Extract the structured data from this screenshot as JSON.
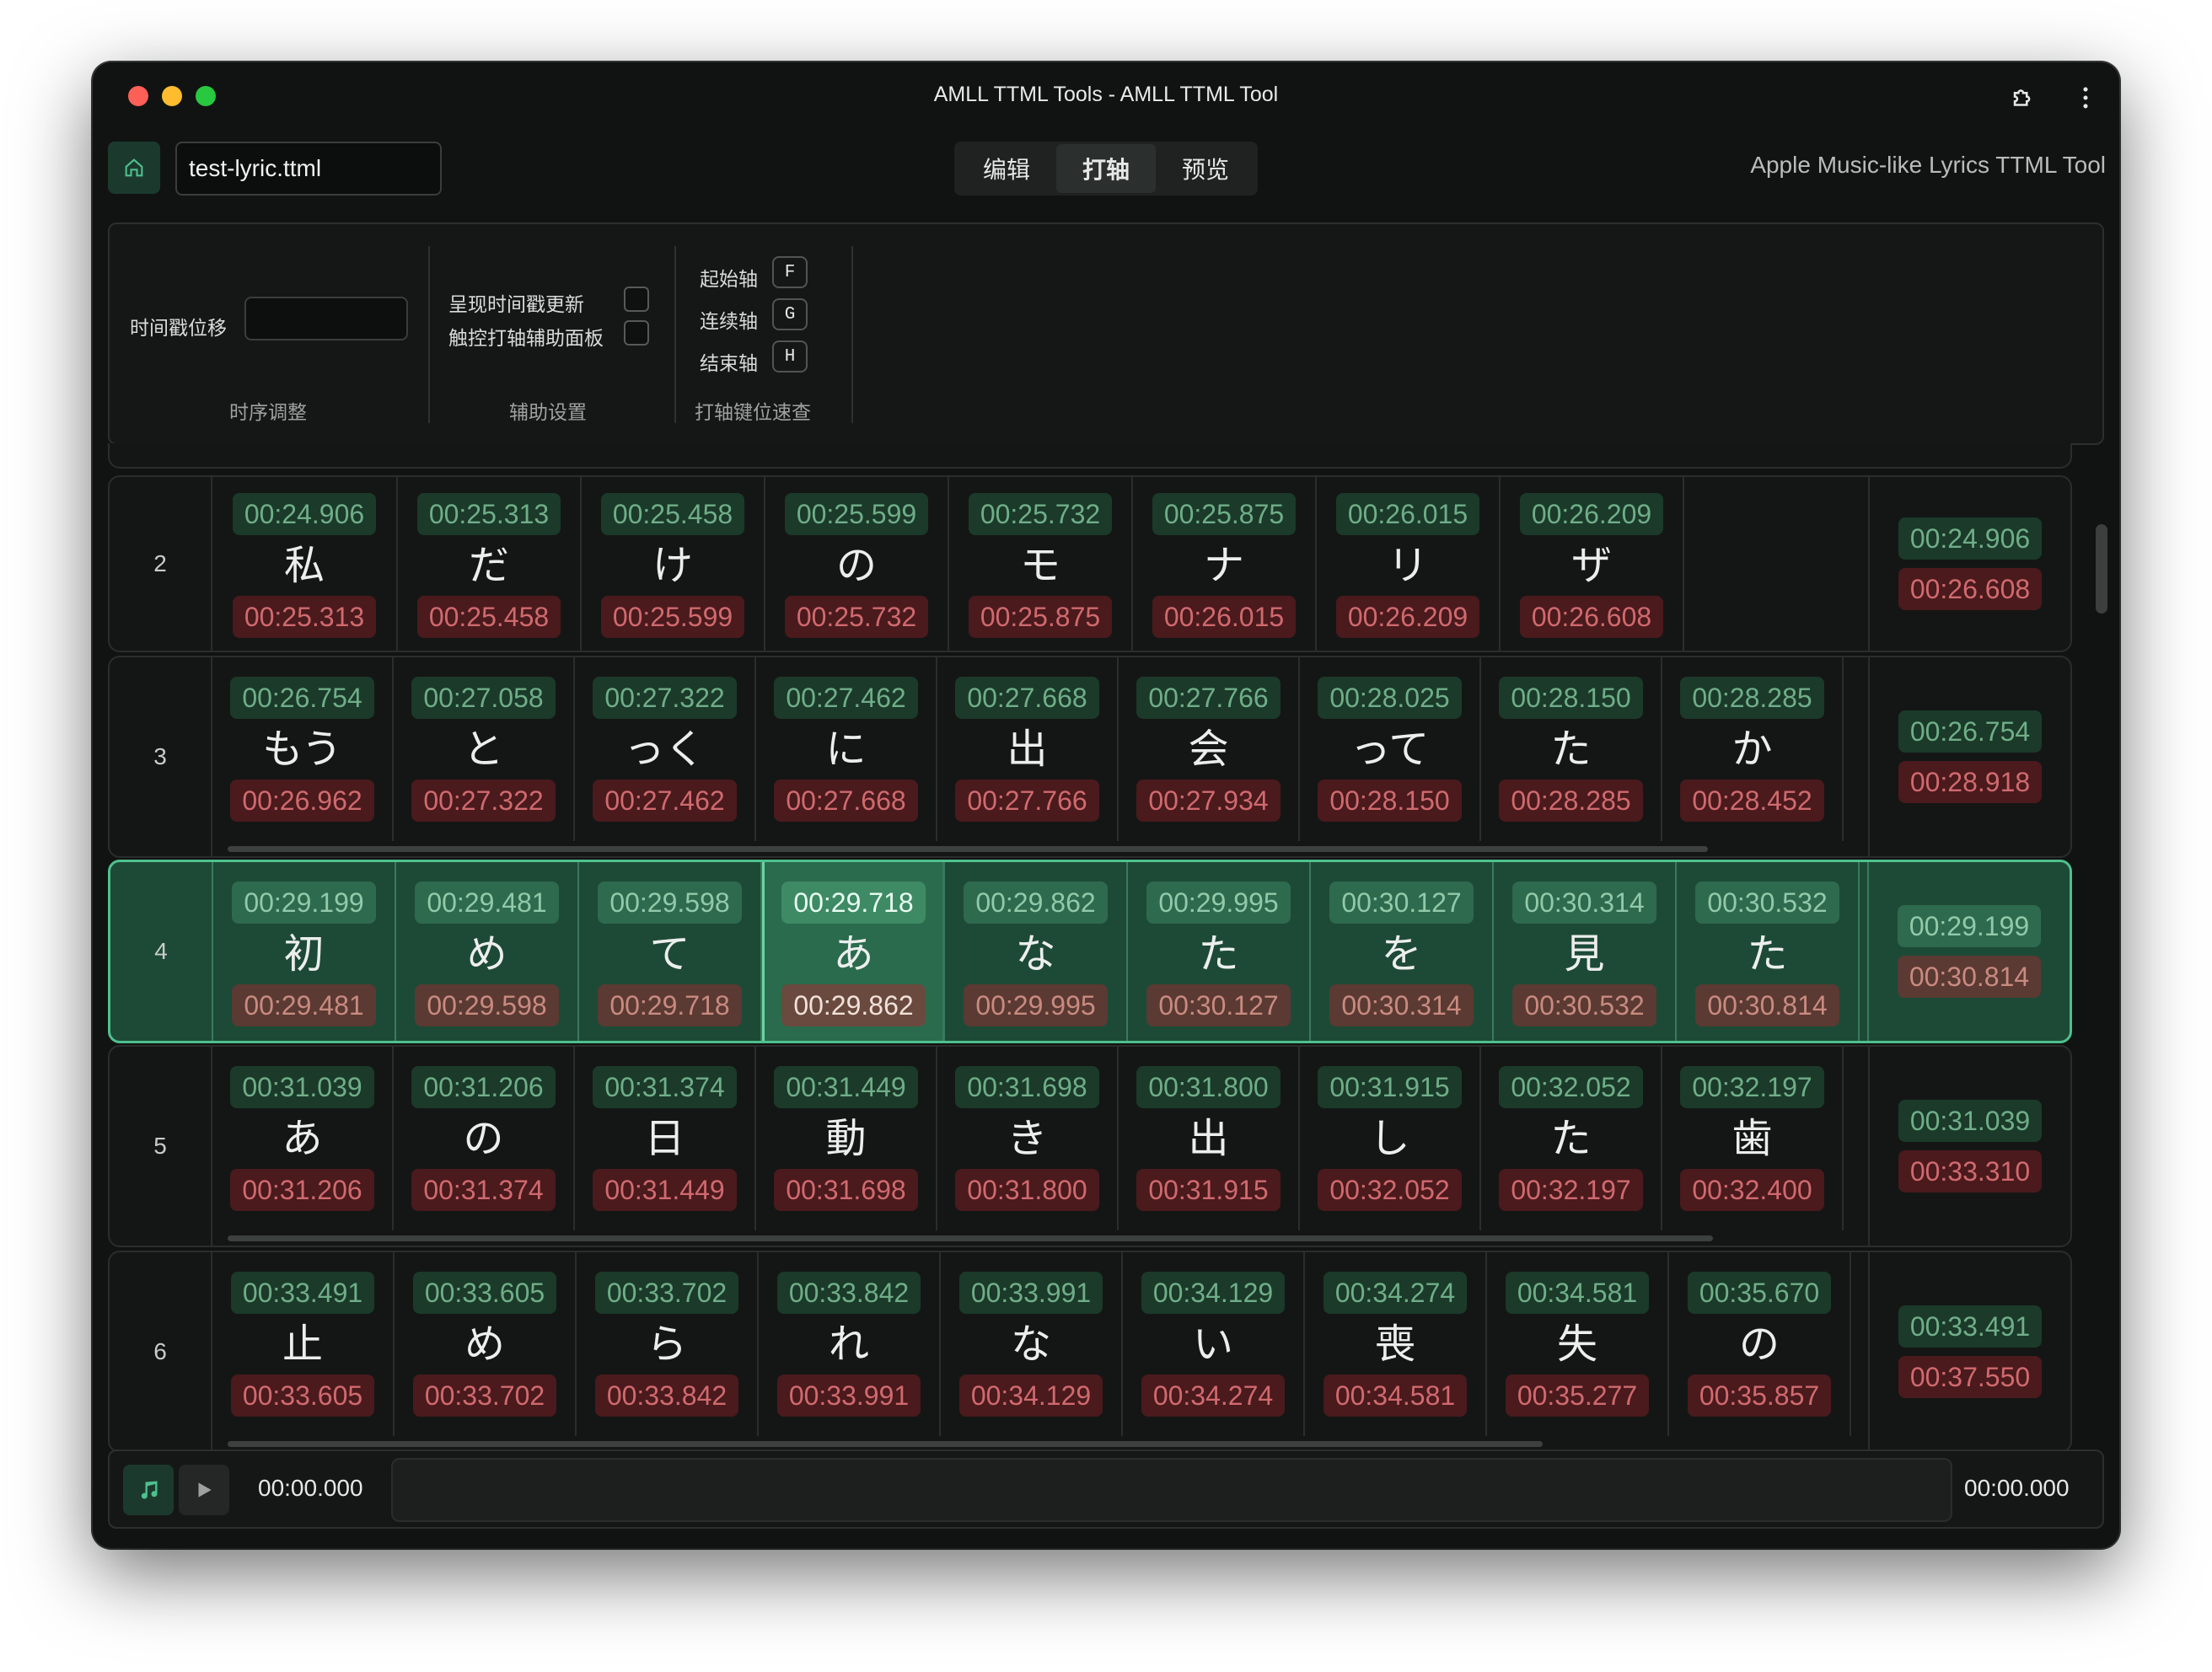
{
  "window": {
    "title": "AMLL TTML Tools - AMLL TTML Tool"
  },
  "header": {
    "file_name": "test-lyric.ttml",
    "tabs": [
      {
        "label": "编辑"
      },
      {
        "label": "打轴"
      },
      {
        "label": "预览"
      }
    ],
    "active_tab": "打轴",
    "app_description": "Apple Music-like Lyrics TTML Tool"
  },
  "settings": {
    "offset_label": "时间戳位移",
    "offset_value": "",
    "timing_group": "时序调整",
    "show_update_label": "呈现时间戳更新",
    "touch_panel_label": "触控打轴辅助面板",
    "assist_group": "辅助设置",
    "keys": [
      {
        "label": "起始轴",
        "key": "F"
      },
      {
        "label": "连续轴",
        "key": "G"
      },
      {
        "label": "结束轴",
        "key": "H"
      }
    ],
    "keys_group": "打轴键位速查"
  },
  "lines": [
    {
      "num": "2",
      "start": "00:24.906",
      "end": "00:26.608",
      "words": [
        {
          "t": "私",
          "s": "00:24.906",
          "e": "00:25.313"
        },
        {
          "t": "だ",
          "s": "00:25.313",
          "e": "00:25.458"
        },
        {
          "t": "け",
          "s": "00:25.458",
          "e": "00:25.599"
        },
        {
          "t": "の",
          "s": "00:25.599",
          "e": "00:25.732"
        },
        {
          "t": "モ",
          "s": "00:25.732",
          "e": "00:25.875"
        },
        {
          "t": "ナ",
          "s": "00:25.875",
          "e": "00:26.015"
        },
        {
          "t": "リ",
          "s": "00:26.015",
          "e": "00:26.209"
        },
        {
          "t": "ザ",
          "s": "00:26.209",
          "e": "00:26.608"
        }
      ]
    },
    {
      "num": "3",
      "start": "00:26.754",
      "end": "00:28.918",
      "words": [
        {
          "t": "もう",
          "s": "00:26.754",
          "e": "00:26.962"
        },
        {
          "t": "と",
          "s": "00:27.058",
          "e": "00:27.322"
        },
        {
          "t": "っく",
          "s": "00:27.322",
          "e": "00:27.462"
        },
        {
          "t": "に",
          "s": "00:27.462",
          "e": "00:27.668"
        },
        {
          "t": "出",
          "s": "00:27.668",
          "e": "00:27.766"
        },
        {
          "t": "会",
          "s": "00:27.766",
          "e": "00:27.934"
        },
        {
          "t": "って",
          "s": "00:28.025",
          "e": "00:28.150"
        },
        {
          "t": "た",
          "s": "00:28.150",
          "e": "00:28.285"
        },
        {
          "t": "か",
          "s": "00:28.285",
          "e": "00:28.452"
        }
      ]
    },
    {
      "num": "4",
      "start": "00:29.199",
      "end": "00:30.814",
      "active": true,
      "current_word": 3,
      "words": [
        {
          "t": "初",
          "s": "00:29.199",
          "e": "00:29.481"
        },
        {
          "t": "め",
          "s": "00:29.481",
          "e": "00:29.598"
        },
        {
          "t": "て",
          "s": "00:29.598",
          "e": "00:29.718"
        },
        {
          "t": "あ",
          "s": "00:29.718",
          "e": "00:29.862"
        },
        {
          "t": "な",
          "s": "00:29.862",
          "e": "00:29.995"
        },
        {
          "t": "た",
          "s": "00:29.995",
          "e": "00:30.127"
        },
        {
          "t": "を",
          "s": "00:30.127",
          "e": "00:30.314"
        },
        {
          "t": "見",
          "s": "00:30.314",
          "e": "00:30.532"
        },
        {
          "t": "た",
          "s": "00:30.532",
          "e": "00:30.814"
        }
      ]
    },
    {
      "num": "5",
      "start": "00:31.039",
      "end": "00:33.310",
      "words": [
        {
          "t": "あ",
          "s": "00:31.039",
          "e": "00:31.206"
        },
        {
          "t": "の",
          "s": "00:31.206",
          "e": "00:31.374"
        },
        {
          "t": "日",
          "s": "00:31.374",
          "e": "00:31.449"
        },
        {
          "t": "動",
          "s": "00:31.449",
          "e": "00:31.698"
        },
        {
          "t": "き",
          "s": "00:31.698",
          "e": "00:31.800"
        },
        {
          "t": "出",
          "s": "00:31.800",
          "e": "00:31.915"
        },
        {
          "t": "し",
          "s": "00:31.915",
          "e": "00:32.052"
        },
        {
          "t": "た",
          "s": "00:32.052",
          "e": "00:32.197"
        },
        {
          "t": "歯",
          "s": "00:32.197",
          "e": "00:32.400"
        }
      ]
    },
    {
      "num": "6",
      "start": "00:33.491",
      "end": "00:37.550",
      "words": [
        {
          "t": "止",
          "s": "00:33.491",
          "e": "00:33.605"
        },
        {
          "t": "め",
          "s": "00:33.605",
          "e": "00:33.702"
        },
        {
          "t": "ら",
          "s": "00:33.702",
          "e": "00:33.842"
        },
        {
          "t": "れ",
          "s": "00:33.842",
          "e": "00:33.991"
        },
        {
          "t": "な",
          "s": "00:33.991",
          "e": "00:34.129"
        },
        {
          "t": "い",
          "s": "00:34.129",
          "e": "00:34.274"
        },
        {
          "t": "喪",
          "s": "00:34.274",
          "e": "00:34.581"
        },
        {
          "t": "失",
          "s": "00:34.581",
          "e": "00:35.277"
        },
        {
          "t": "の",
          "s": "00:35.670",
          "e": "00:35.857"
        }
      ]
    }
  ],
  "player": {
    "current_time": "00:00.000",
    "total_time": "00:00.000"
  },
  "colors": {
    "accent": "#4ec08e",
    "start_pill": "#1b3a2a",
    "end_pill": "#4a1a1d"
  }
}
